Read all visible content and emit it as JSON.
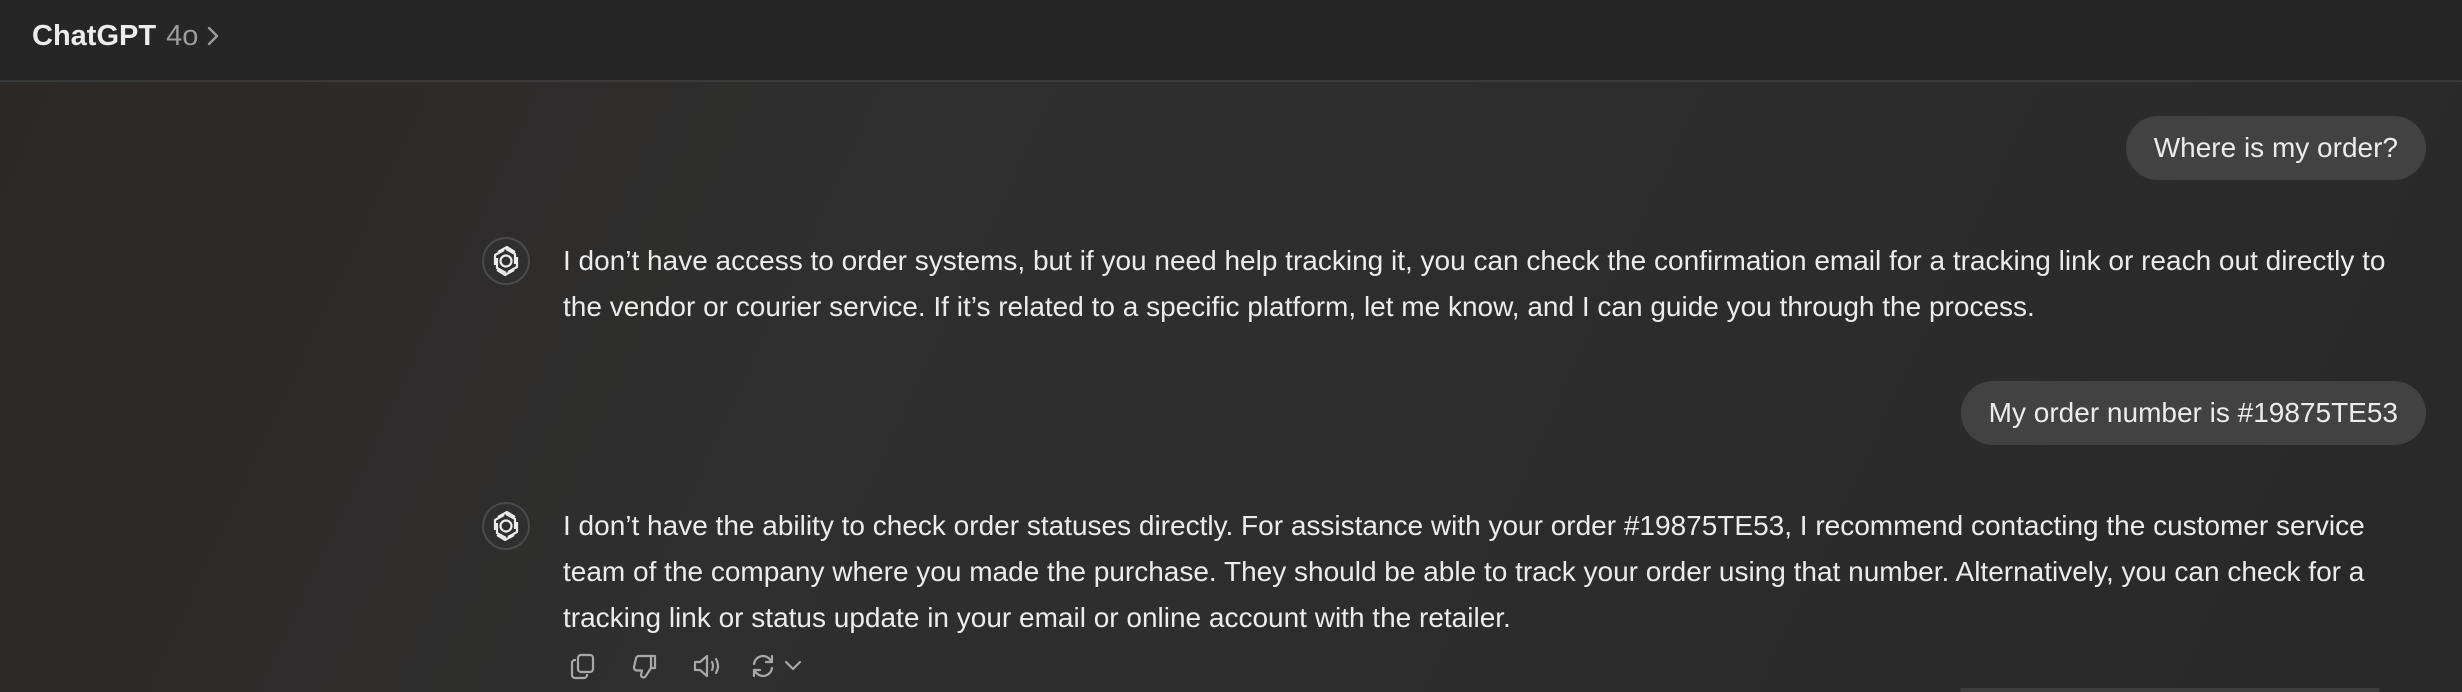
{
  "header": {
    "app_title": "ChatGPT",
    "model": "4o"
  },
  "conversation": [
    {
      "role": "user",
      "text": "Where is my order?"
    },
    {
      "role": "assistant",
      "text": "I don’t have access to order systems, but if you need help tracking it, you can check the confirmation email for a tracking link or reach out directly to the vendor or courier service. If it’s related to a specific platform, let me know, and I can guide you through the process."
    },
    {
      "role": "user",
      "text": "My order number is #19875TE53"
    },
    {
      "role": "assistant",
      "text": "I don’t have the ability to check order statuses directly. For assistance with your order #19875TE53, I recommend contacting the customer service team of the company where you made the purchase. They should be able to track your order using that number. Alternatively, you can check for a tracking link or status update in your email or online account with the retailer."
    }
  ],
  "message_actions": [
    "copy-icon",
    "thumbs-down-icon",
    "read-aloud-icon",
    "regenerate-icon",
    "chevron-down-icon"
  ],
  "colors": {
    "background": "#2c2c2c",
    "header": "#262626",
    "user_bubble": "#424242",
    "text": "#ececec",
    "muted": "#9b9b9b"
  }
}
